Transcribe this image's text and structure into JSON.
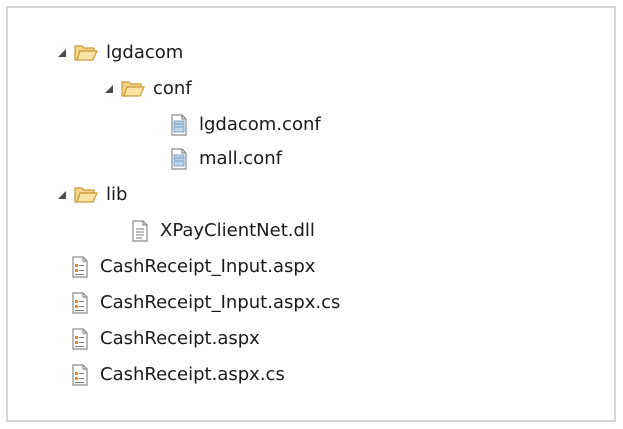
{
  "tree": {
    "nodes": [
      {
        "label": "lgdacom",
        "type": "folder",
        "expanded": true
      },
      {
        "label": "conf",
        "type": "folder",
        "expanded": true
      },
      {
        "label": "lgdacom.conf",
        "type": "conf-file"
      },
      {
        "label": "mall.conf",
        "type": "conf-file"
      },
      {
        "label": "lib",
        "type": "folder",
        "expanded": true
      },
      {
        "label": "XPayClientNet.dll",
        "type": "dll-file"
      },
      {
        "label": "CashReceipt_Input.aspx",
        "type": "aspx-file"
      },
      {
        "label": "CashReceipt_Input.aspx.cs",
        "type": "aspx-file"
      },
      {
        "label": "CashReceipt.aspx",
        "type": "aspx-file"
      },
      {
        "label": "CashReceipt.aspx.cs",
        "type": "aspx-file"
      }
    ]
  },
  "colors": {
    "border": "#d7d7d7",
    "folder_fill": "#f6d58b",
    "folder_stroke": "#c99a3a",
    "text": "#1a1a1a",
    "file_icon_accent": "#e08a2c"
  }
}
